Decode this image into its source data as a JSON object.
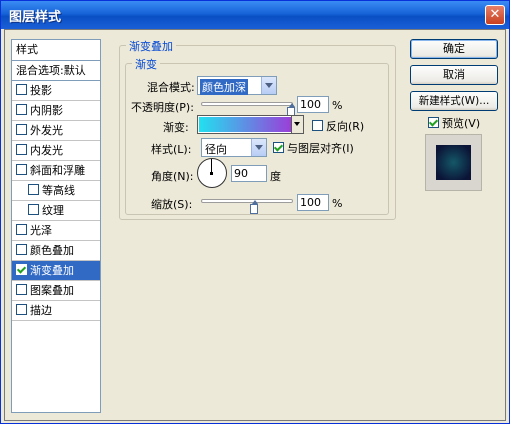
{
  "window": {
    "title": "图层样式",
    "close_glyph": "✕"
  },
  "style_list": {
    "header": "样式",
    "blend_default": "混合选项:默认",
    "items": [
      {
        "label": "投影",
        "checked": false,
        "sub": false
      },
      {
        "label": "内阴影",
        "checked": false,
        "sub": false
      },
      {
        "label": "外发光",
        "checked": false,
        "sub": false
      },
      {
        "label": "内发光",
        "checked": false,
        "sub": false
      },
      {
        "label": "斜面和浮雕",
        "checked": false,
        "sub": false
      },
      {
        "label": "等高线",
        "checked": false,
        "sub": true
      },
      {
        "label": "纹理",
        "checked": false,
        "sub": true
      },
      {
        "label": "光泽",
        "checked": false,
        "sub": false
      },
      {
        "label": "颜色叠加",
        "checked": false,
        "sub": false
      },
      {
        "label": "渐变叠加",
        "checked": true,
        "sub": false,
        "selected": true
      },
      {
        "label": "图案叠加",
        "checked": false,
        "sub": false
      },
      {
        "label": "描边",
        "checked": false,
        "sub": false
      }
    ]
  },
  "gradient_overlay": {
    "group_title": "渐变叠加",
    "inner_title": "渐变",
    "blend_mode_label": "混合模式:",
    "blend_mode_value": "颜色加深",
    "opacity_label": "不透明度(P):",
    "opacity_value": "100",
    "opacity_unit": "%",
    "opacity_fraction": 1.0,
    "gradient_label": "渐变:",
    "gradient_colors": [
      "#22e0f0",
      "#9a3fd8"
    ],
    "reverse_label": "反向(R)",
    "reverse_checked": false,
    "style_label": "样式(L):",
    "style_value": "径向",
    "align_label": "与图层对齐(I)",
    "align_checked": true,
    "angle_label": "角度(N):",
    "angle_value": "90",
    "angle_unit": "度",
    "scale_label": "缩放(S):",
    "scale_value": "100",
    "scale_unit": "%",
    "scale_fraction": 0.6
  },
  "buttons": {
    "ok": "确定",
    "cancel": "取消",
    "new_style": "新建样式(W)...",
    "preview_label": "预览(V)",
    "preview_checked": true
  },
  "colors": {
    "accent": "#316ac5",
    "title_blue": "#0046d5",
    "preview_center": "#145868",
    "preview_edge": "#0b1436"
  }
}
